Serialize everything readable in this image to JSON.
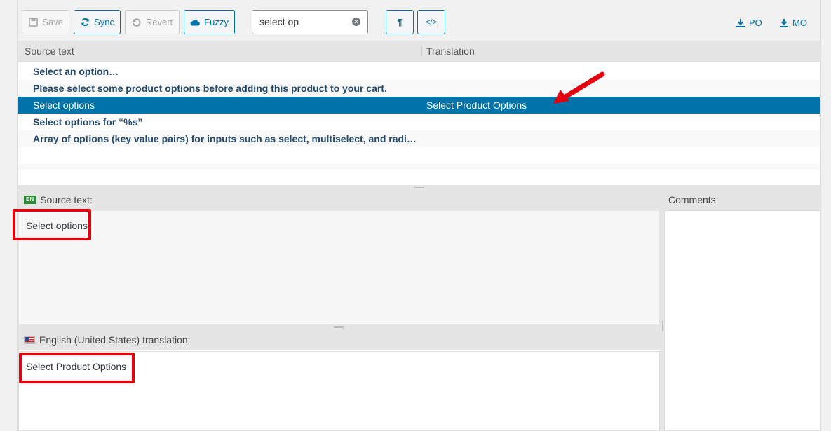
{
  "toolbar": {
    "save_label": "Save",
    "sync_label": "Sync",
    "revert_label": "Revert",
    "fuzzy_label": "Fuzzy",
    "search_value": "select op",
    "pilcrow_label": "¶",
    "code_label": "</>",
    "po_label": "PO",
    "mo_label": "MO"
  },
  "list": {
    "col_source": "Source text",
    "col_translation": "Translation",
    "rows": [
      {
        "source": "Select an option…",
        "translation": ""
      },
      {
        "source": "Please select some product options before adding this product to your cart.",
        "translation": ""
      },
      {
        "source": "Select options",
        "translation": "Select Product Options"
      },
      {
        "source": "Select options for “%s”",
        "translation": ""
      },
      {
        "source": "Array of options (key value pairs) for inputs such as select, multiselect, and radi…",
        "translation": ""
      }
    ]
  },
  "source_panel": {
    "lang_badge": "EN",
    "heading": "Source text:",
    "text": "Select options"
  },
  "translation_panel": {
    "heading": "English (United States) translation:",
    "text": "Select Product Options"
  },
  "comments_panel": {
    "heading": "Comments:"
  },
  "colors": {
    "accent": "#0073aa",
    "highlight": "#e3000f"
  }
}
